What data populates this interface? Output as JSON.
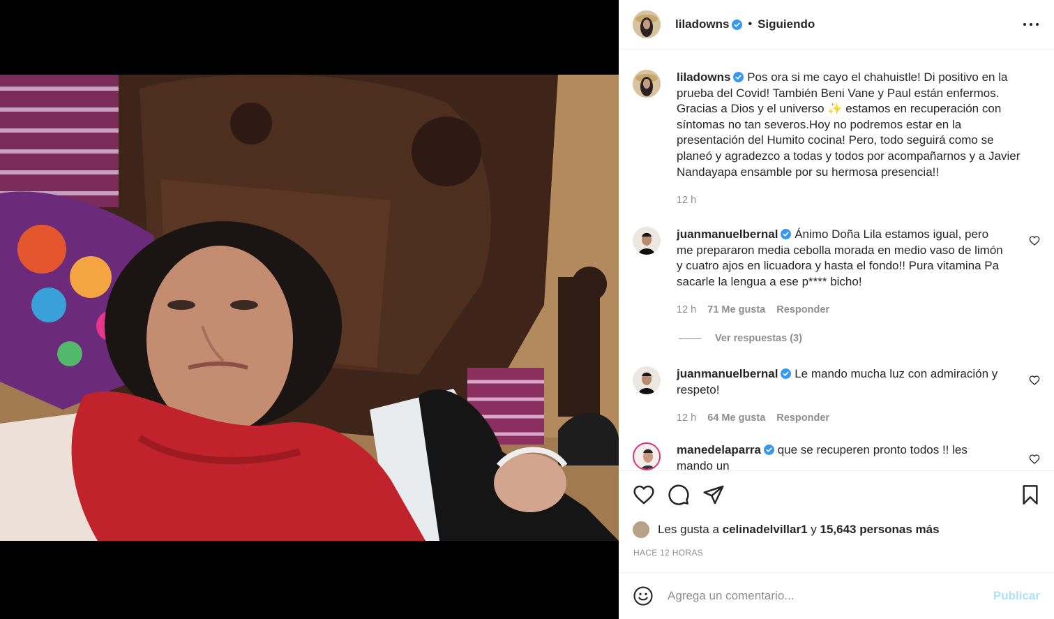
{
  "post": {
    "username": "liladowns",
    "follow_state": "Siguiendo",
    "dot": "•",
    "caption": "Pos ora si me cayo el chahuistle! Di positivo en la prueba del Covid! También Beni Vane y Paul están enfermos. Gracias a Dios y el universo ✨ estamos en recuperación con síntomas no tan severos.Hoy no podremos estar en la presentación del Humito cocina! Pero, todo seguirá como se planeó y agradezco a todas y todos por acompañarnos y a Javier Nandayapa ensamble por su hermosa presencia!!",
    "caption_time": "12 h"
  },
  "comments": [
    {
      "username": "juanmanuelbernal",
      "text": "Ánimo Doña Lila estamos igual, pero me prepararon media cebolla morada en medio vaso de limón y cuatro ajos en licuadora y hasta el fondo!! Pura vitamina Pa sacarle la lengua a ese p**** bicho!",
      "time": "12 h",
      "likes": "71 Me gusta",
      "reply": "Responder",
      "view_replies": "Ver respuestas (3)"
    },
    {
      "username": "juanmanuelbernal",
      "text": "Le mando mucha luz con admiración y respeto!",
      "time": "12 h",
      "likes": "64 Me gusta",
      "reply": "Responder"
    },
    {
      "username": "manedelaparra",
      "text": "que se recuperen pronto todos !! les mando un"
    }
  ],
  "likes_summary": {
    "prefix": "Les gusta a",
    "user": "celinadelvillar1",
    "connector": "y",
    "others": "15,643 personas más"
  },
  "time_ago": "HACE 12 HORAS",
  "add_comment": {
    "placeholder": "Agrega un comentario...",
    "publish": "Publicar"
  },
  "colors": {
    "verified": "#3897f0",
    "publish_disabled": "#b2dffc",
    "muted": "#8e8e8e"
  },
  "icons": [
    "more-icon",
    "verified-icon",
    "heart-icon",
    "comment-icon",
    "share-icon",
    "bookmark-icon",
    "emoji-icon"
  ]
}
